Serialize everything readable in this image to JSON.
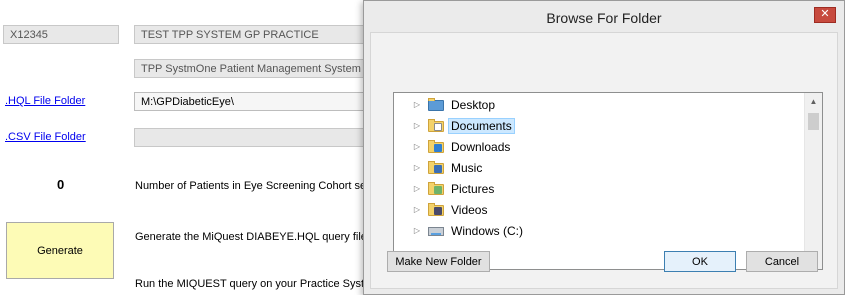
{
  "main": {
    "practice_code": "X12345",
    "practice_name": "TEST TPP SYSTEM GP PRACTICE",
    "system_name": "TPP SystmOne Patient Management System",
    "hql_link": ".HQL File Folder",
    "hql_path": "M:\\GPDiabeticEye\\",
    "csv_link": ".CSV File Folder",
    "csv_path": "",
    "patient_count": "0",
    "patient_count_label": "Number of Patients in Eye Screening Cohort sent",
    "generate_button": "Generate",
    "generate_desc": "Generate the MiQuest DIABEYE.HQL query file",
    "run_desc": "Run the MIQUEST query on your Practice Syste"
  },
  "dialog": {
    "title": "Browse For Folder",
    "close_glyph": "✕",
    "folders": [
      {
        "label": "Desktop",
        "icon": "desktop-folder-icon",
        "selected": false
      },
      {
        "label": "Documents",
        "icon": "documents-folder-icon",
        "selected": true
      },
      {
        "label": "Downloads",
        "icon": "downloads-folder-icon",
        "selected": false
      },
      {
        "label": "Music",
        "icon": "music-folder-icon",
        "selected": false
      },
      {
        "label": "Pictures",
        "icon": "pictures-folder-icon",
        "selected": false
      },
      {
        "label": "Videos",
        "icon": "videos-folder-icon",
        "selected": false
      },
      {
        "label": "Windows (C:)",
        "icon": "drive-icon",
        "selected": false
      }
    ],
    "make_new_folder_button": "Make New Folder",
    "ok_button": "OK",
    "cancel_button": "Cancel"
  },
  "colors": {
    "generate_button_bg": "#fdfbb6",
    "selection_bg": "#cce8ff",
    "close_button": "#c74a3e",
    "link": "#0000ee"
  }
}
